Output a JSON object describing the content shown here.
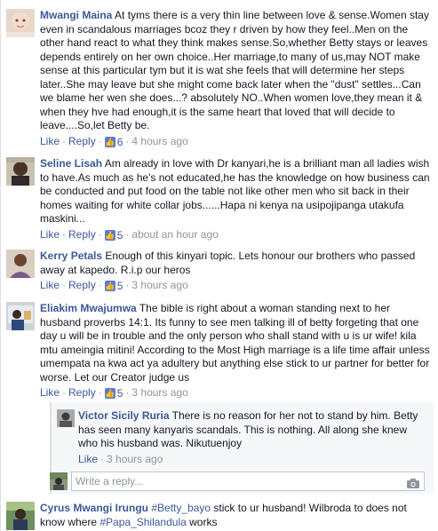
{
  "comments": [
    {
      "name": "Mwangi Maina",
      "text": "At tyms there is a very thin line between love & sense.Women stay even in scandalous marriages bcoz they r driven by how they feel..Men on the other hand react to what they think makes sense.So,whether Betty stays or leaves depends entirely on her own choice..Her marriage,to many of us,may NOT make sense at this particular tym but it is wat she feels that will determine her steps later..She may leave but she might come back later when the \"dust\" settles...Can we blame her wen she does...? absolutely NO..When women love,they mean it & when they hve had enough,it is the same heart that loved that will decide to leave....So,let Betty be.",
      "like": "Like",
      "reply": "Reply",
      "likes": "6",
      "time": "4 hours ago"
    },
    {
      "name": "Seline Lisah",
      "text": "Am already in love with Dr kanyari,he is a brilliant man all ladies wish to have.As much as he's not educated,he has the knowledge on how business can be conducted and put food on the table not like other men who sit back in their homes waiting for white collar jobs......Hapa ni kenya na usipojipanga utakufa maskini...",
      "like": "Like",
      "reply": "Reply",
      "likes": "5",
      "time": "about an hour ago"
    },
    {
      "name": "Kerry Petals",
      "text": "Enough of this kinyari topic. Lets honour our brothers who passed away at kapedo. R.i.p our heros",
      "like": "Like",
      "reply": "Reply",
      "likes": "5",
      "time": "3 hours ago"
    },
    {
      "name": "Eliakim Mwajumwa",
      "text": "The bible is right about a woman standing next to her husband proverbs 14:1. Its funny to see men talking ill of betty forgeting that one day u will be in trouble and the only person who shall stand with u is ur wife! kila mtu ameingia mitini! According to the Most High marriage is a life time affair unless umempata na kwa act ya adultery but anything else stick to ur partner for better for worse. Let our Creator judge us",
      "like": "Like",
      "reply": "Reply",
      "likes": "5",
      "time": "3 hours ago"
    }
  ],
  "reply": {
    "name": "Victor Sicily Ruria",
    "text": "There is no reason for her not to stand by him. Betty has seen many kanyaris scandals. This is nothing. All along she knew who his husband was. Nikutuenjoy",
    "like": "Like",
    "time": "3 hours ago"
  },
  "write_reply": {
    "placeholder": "Write a reply...",
    "camera_icon": "camera-icon"
  },
  "last_comment": {
    "name": "Cyrus Mwangi Irungu",
    "hashtag1": "#Betty_bayo",
    "text_mid": " stick to ur husband! Wilbroda to does not know where ",
    "hashtag2": "#Papa_Shilandula",
    "text_end": " works"
  },
  "colors": {
    "link": "#3b5998",
    "meta": "#90949c",
    "text": "#141823",
    "like_badge": "#5b7bd5"
  },
  "icons": {
    "like_badge": "thumbs-up-icon",
    "separator": "middle-dot"
  }
}
